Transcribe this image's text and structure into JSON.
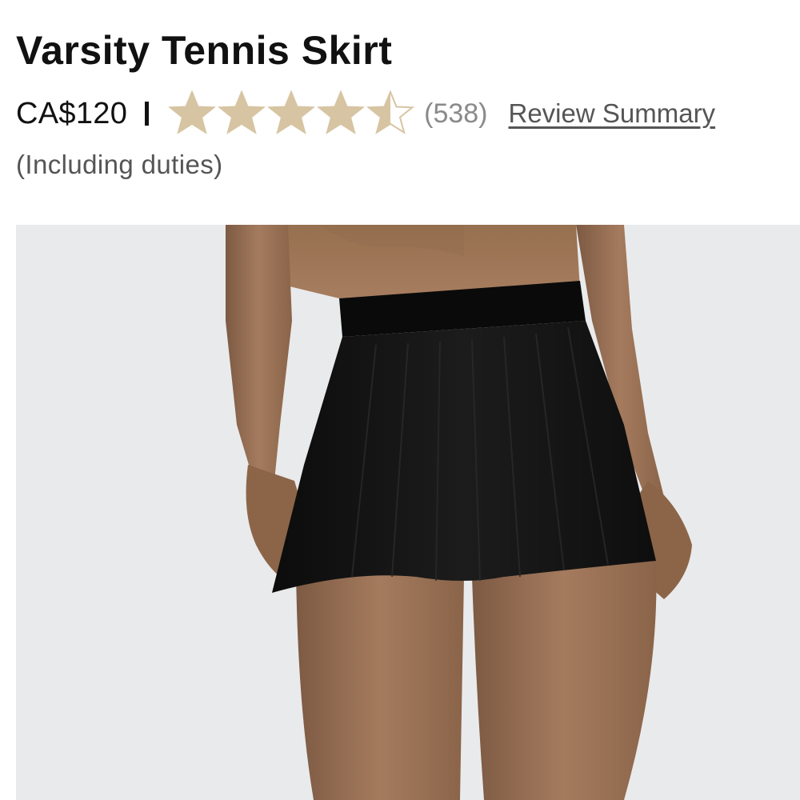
{
  "product": {
    "title": "Varsity Tennis Skirt",
    "price": "CA$120",
    "duties_note": "(Including duties)"
  },
  "rating": {
    "value": 4.5,
    "max": 5,
    "review_count": "(538)",
    "review_link_label": "Review Summary",
    "star_color": "#d7c4a2"
  },
  "image": {
    "subject": "black pleated tennis skirt worn by model",
    "background_color": "#e9eaec"
  }
}
